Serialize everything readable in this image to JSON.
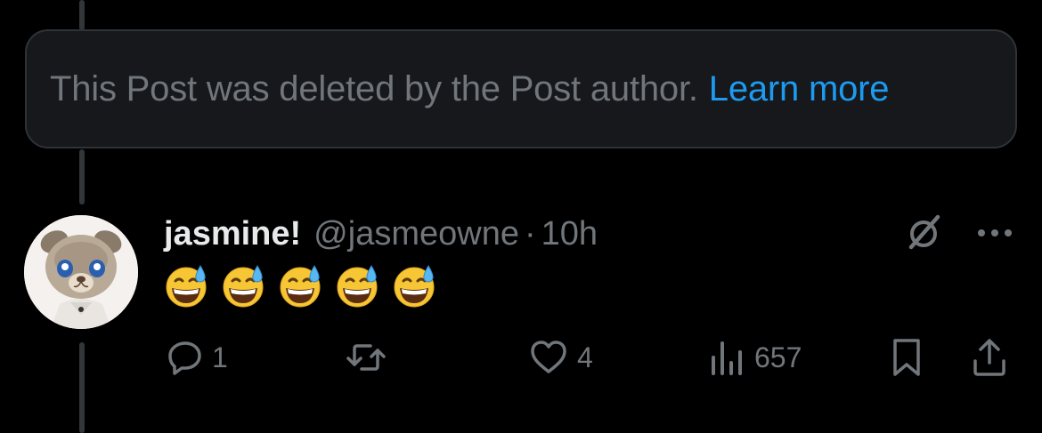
{
  "deleted_notice": {
    "text": "This Post was deleted by the Post author.",
    "link_label": "Learn more"
  },
  "post": {
    "display_name": "jasmine!",
    "handle": "@jasmeowne",
    "separator": "·",
    "timestamp": "10h",
    "text": "😅😅😅😅😅",
    "emoji_count": 5
  },
  "actions": {
    "replies": "1",
    "likes": "4",
    "views": "657"
  },
  "colors": {
    "background": "#000000",
    "notice_bg": "#16181c",
    "muted": "#71767b",
    "link": "#1d9bf0",
    "primary_text": "#e7e9ea"
  },
  "icons": {
    "reply": "reply-icon",
    "repost": "repost-icon",
    "like": "heart-icon",
    "views": "views-icon",
    "bookmark": "bookmark-icon",
    "share": "share-icon",
    "grok": "grok-icon",
    "more": "more-icon"
  }
}
